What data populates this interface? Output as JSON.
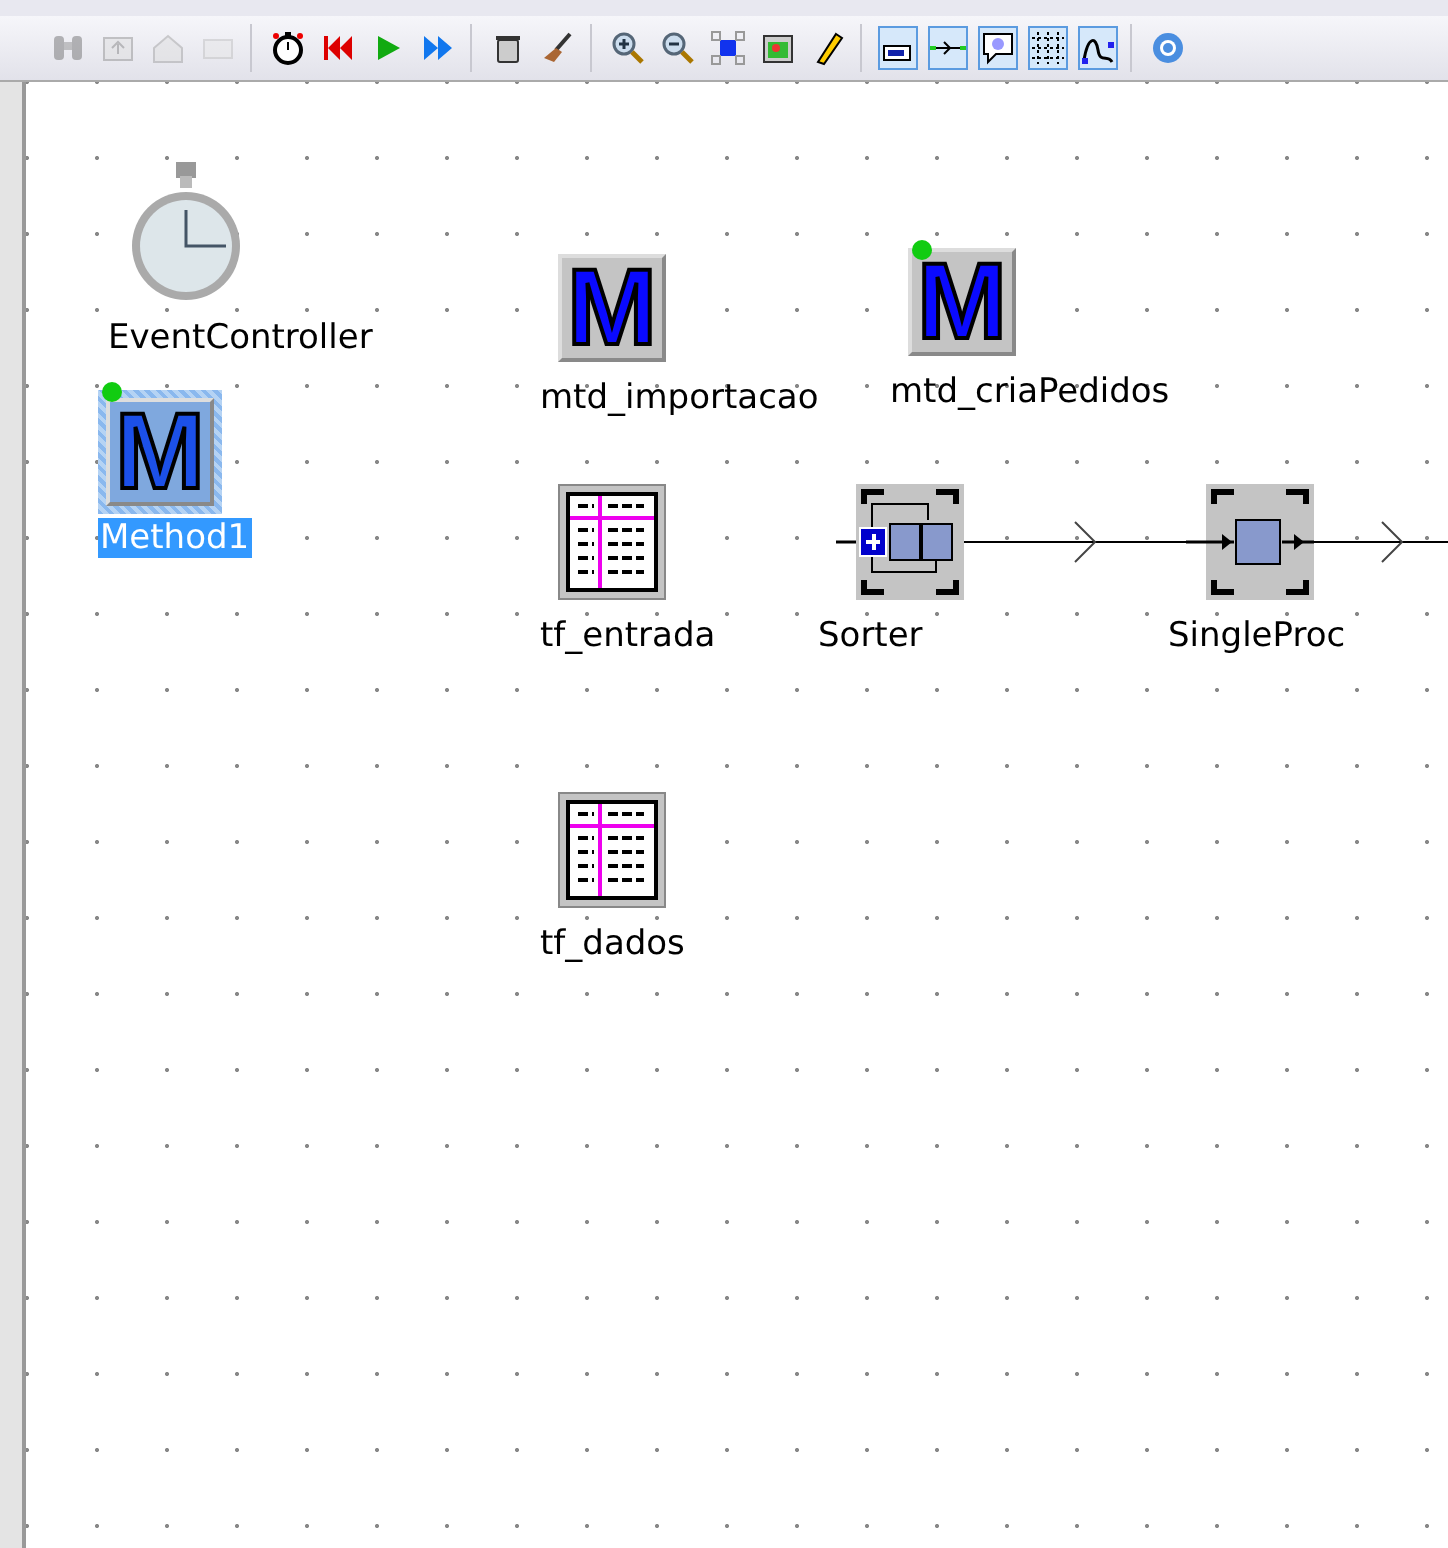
{
  "toolbar": {
    "groups": [
      [
        {
          "kind": "binoculars",
          "disabled": true,
          "selected": false
        },
        {
          "kind": "folder-up",
          "disabled": true,
          "selected": false
        },
        {
          "kind": "home",
          "disabled": true,
          "selected": false
        },
        {
          "kind": "view3d",
          "disabled": true,
          "selected": false
        }
      ],
      [
        {
          "kind": "stopwatch",
          "disabled": false,
          "selected": false
        },
        {
          "kind": "reset",
          "disabled": false,
          "selected": false
        },
        {
          "kind": "start",
          "disabled": false,
          "selected": false
        },
        {
          "kind": "fast-forward",
          "disabled": false,
          "selected": false
        }
      ],
      [
        {
          "kind": "trash",
          "disabled": false,
          "selected": false
        },
        {
          "kind": "broom",
          "disabled": false,
          "selected": false
        }
      ],
      [
        {
          "kind": "zoom-in",
          "disabled": false,
          "selected": false
        },
        {
          "kind": "zoom-out",
          "disabled": false,
          "selected": false
        },
        {
          "kind": "fit",
          "disabled": false,
          "selected": false
        },
        {
          "kind": "picture",
          "disabled": false,
          "selected": false
        },
        {
          "kind": "pencil",
          "disabled": false,
          "selected": false
        }
      ],
      [
        {
          "kind": "icon-view",
          "disabled": false,
          "selected": true
        },
        {
          "kind": "connector",
          "disabled": false,
          "selected": true
        },
        {
          "kind": "comment",
          "disabled": false,
          "selected": true
        },
        {
          "kind": "grid",
          "disabled": false,
          "selected": true
        },
        {
          "kind": "curve",
          "disabled": false,
          "selected": true
        }
      ],
      [
        {
          "kind": "help",
          "disabled": false,
          "selected": false
        }
      ]
    ]
  },
  "canvas": {
    "objects": [
      {
        "kind": "event-controller",
        "label": "EventController",
        "selected": false,
        "active": false
      },
      {
        "kind": "method",
        "glyph": "M",
        "label": "Method1",
        "selected": true,
        "active": true
      },
      {
        "kind": "method",
        "glyph": "M",
        "label": "mtd_importacao",
        "selected": false,
        "active": false
      },
      {
        "kind": "method",
        "glyph": "M",
        "label": "mtd_criaPedidos",
        "selected": false,
        "active": true
      },
      {
        "kind": "table",
        "label": "tf_entrada",
        "selected": false,
        "active": false
      },
      {
        "kind": "sorter",
        "label": "Sorter",
        "selected": false,
        "active": false
      },
      {
        "kind": "single-proc",
        "label": "SingleProc",
        "selected": false,
        "active": false
      },
      {
        "kind": "table",
        "label": "tf_dados",
        "selected": false,
        "active": false
      }
    ]
  }
}
